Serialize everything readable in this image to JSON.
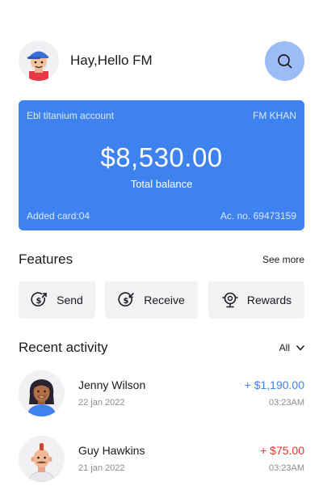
{
  "header": {
    "greeting": "Hay,Hello FM",
    "search_icon": "search-icon"
  },
  "card": {
    "account_name": "Ebl titanium account",
    "holder": "FM KHAN",
    "balance": "$8,530.00",
    "balance_label": "Total balance",
    "added_cards": "Added card:04",
    "account_no": "Ac. no. 69473159",
    "color": "#3d82ef"
  },
  "features": {
    "title": "Features",
    "see_more": "See more",
    "items": [
      {
        "label": "Send",
        "icon": "dollar-send-icon"
      },
      {
        "label": "Receive",
        "icon": "dollar-receive-icon"
      },
      {
        "label": "Rewards",
        "icon": "trophy-icon"
      }
    ]
  },
  "recent": {
    "title": "Recent activity",
    "filter": "All",
    "items": [
      {
        "name": "Jenny Wilson",
        "date": "22 jan 2022",
        "amount": "+ $1,190.00",
        "time": "03:23AM",
        "amount_color": "#3d82ef"
      },
      {
        "name": "Guy Hawkins",
        "date": "21 jan 2022",
        "amount": "+ $75.00",
        "time": "03:23AM",
        "amount_color": "#e5322d"
      }
    ]
  }
}
